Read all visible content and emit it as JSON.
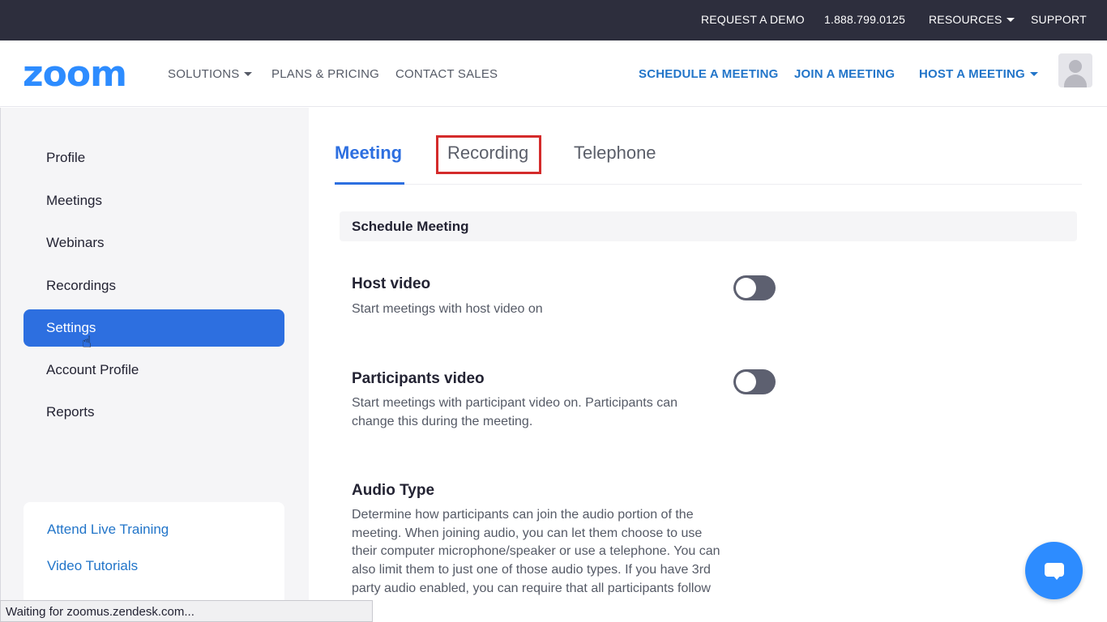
{
  "topbar": {
    "request_demo": "REQUEST A DEMO",
    "phone": "1.888.799.0125",
    "resources": "RESOURCES",
    "support": "SUPPORT"
  },
  "nav": {
    "logo": "zoom",
    "solutions": "SOLUTIONS",
    "plans": "PLANS & PRICING",
    "contact": "CONTACT SALES",
    "schedule": "SCHEDULE A MEETING",
    "join": "JOIN A MEETING",
    "host": "HOST A MEETING"
  },
  "sidebar": {
    "items": [
      {
        "label": "Profile"
      },
      {
        "label": "Meetings"
      },
      {
        "label": "Webinars"
      },
      {
        "label": "Recordings"
      },
      {
        "label": "Settings",
        "active": true
      },
      {
        "label": "Account Profile"
      },
      {
        "label": "Reports"
      }
    ],
    "help": [
      {
        "label": "Attend Live Training"
      },
      {
        "label": "Video Tutorials"
      }
    ]
  },
  "tabs": [
    {
      "label": "Meeting",
      "active": true
    },
    {
      "label": "Recording",
      "highlighted": true
    },
    {
      "label": "Telephone"
    }
  ],
  "section": {
    "title": "Schedule Meeting"
  },
  "settings": [
    {
      "title": "Host video",
      "desc": "Start meetings with host video on",
      "enabled": false
    },
    {
      "title": "Participants video",
      "desc": "Start meetings with participant video on. Participants can change this during the meeting.",
      "enabled": false
    },
    {
      "title": "Audio Type",
      "desc": "Determine how participants can join the audio portion of the meeting. When joining audio, you can let them choose to use their computer microphone/speaker or use a telephone. You can also limit them to just one of those audio types. If you have 3rd party audio enabled, you can require that all participants follow the"
    }
  ],
  "status": "Waiting for zoomus.zendesk.com...",
  "colors": {
    "accent": "#2d6fe0",
    "brand": "#2d8cff",
    "highlight": "#d42b2b",
    "topbar": "#2d2e3d"
  }
}
